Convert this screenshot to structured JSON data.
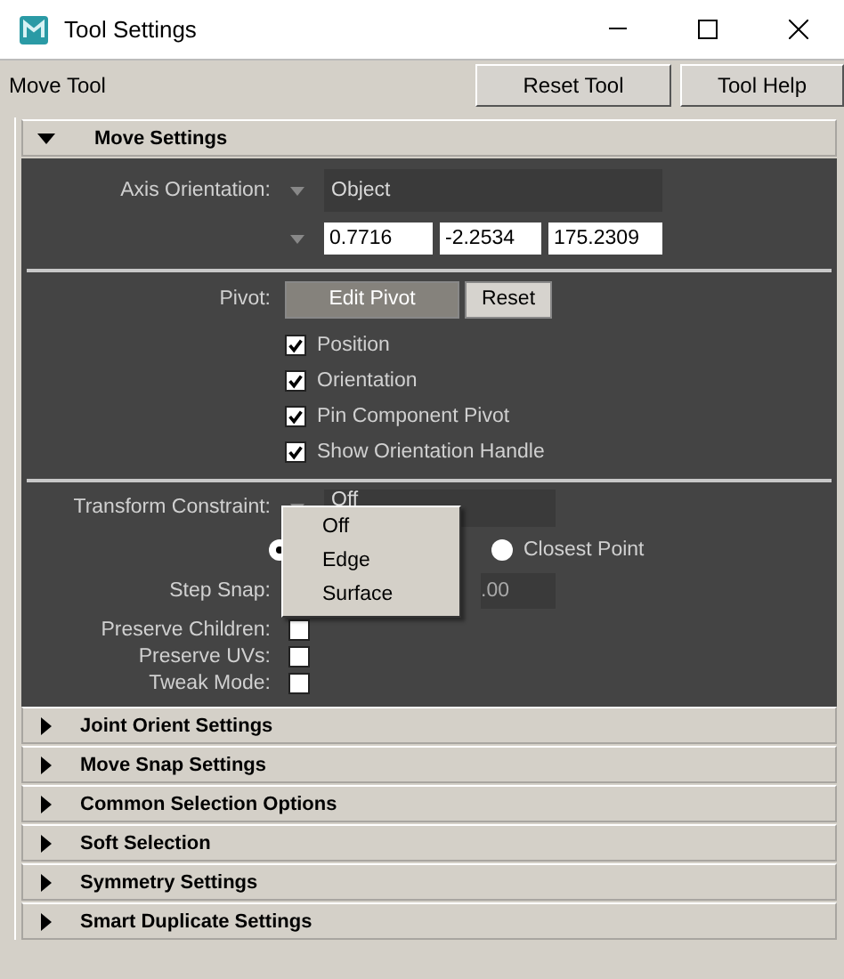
{
  "window": {
    "title": "Tool Settings"
  },
  "tool": {
    "name": "Move Tool",
    "buttons": [
      "Reset Tool",
      "Tool Help"
    ]
  },
  "sections": [
    {
      "title": "Move Settings",
      "expanded": true
    },
    {
      "title": "Joint Orient Settings",
      "expanded": false
    },
    {
      "title": "Move Snap Settings",
      "expanded": false
    },
    {
      "title": "Common Selection Options",
      "expanded": false
    },
    {
      "title": "Soft Selection",
      "expanded": false
    },
    {
      "title": "Symmetry Settings",
      "expanded": false
    },
    {
      "title": "Smart Duplicate Settings",
      "expanded": false
    }
  ],
  "move_settings": {
    "axis_orientation": {
      "label": "Axis Orientation:",
      "value": "Object"
    },
    "axis_values": [
      "0.7716",
      "-2.2534",
      "175.2309"
    ],
    "pivot": {
      "label": "Pivot:",
      "buttons": [
        {
          "label": "Edit Pivot",
          "disabled": true
        },
        {
          "label": "Reset",
          "disabled": false
        }
      ]
    },
    "pivot_options": [
      {
        "label": "Position",
        "checked": true
      },
      {
        "label": "Orientation",
        "checked": true
      },
      {
        "label": "Pin Component Pivot",
        "checked": true
      },
      {
        "label": "Show Orientation Handle",
        "checked": true
      }
    ],
    "transform_constraint": {
      "label": "Transform Constraint:",
      "value": "Off"
    },
    "constraint_modes": [
      {
        "selected": true
      },
      {
        "label": "Closest Point",
        "selected": false
      }
    ],
    "step_snap": {
      "label": "Step Snap:",
      "value": ".00"
    },
    "preserve_options": [
      {
        "label": "Preserve Children:",
        "checked": false
      },
      {
        "label": "Preserve UVs:",
        "checked": false
      },
      {
        "label": "Tweak Mode:",
        "checked": false
      }
    ]
  },
  "dropdown_menu": {
    "items": [
      "Off",
      "Edge",
      "Surface"
    ]
  }
}
